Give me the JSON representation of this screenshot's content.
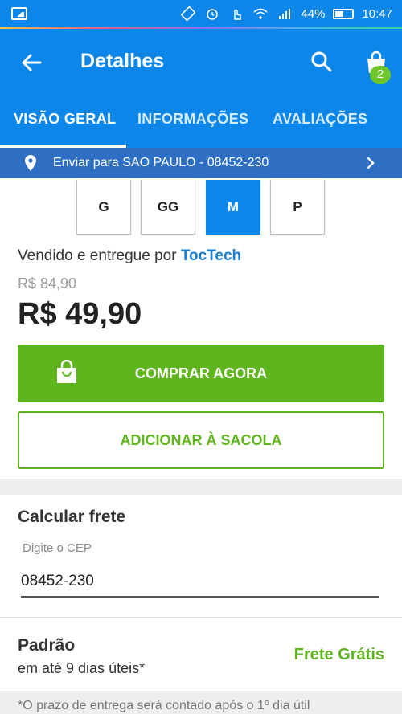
{
  "status_bar": {
    "battery": "44%",
    "time": "10:47"
  },
  "app_bar": {
    "title": "Detalhes",
    "cart_count": "2"
  },
  "tabs": [
    {
      "label": "VISÃO GERAL",
      "active": true
    },
    {
      "label": "INFORMAÇÕES",
      "active": false
    },
    {
      "label": "AVALIAÇÕES",
      "active": false
    }
  ],
  "shipping_bar": {
    "text": "Enviar para SAO PAULO - 08452-230"
  },
  "sizes": [
    {
      "label": "G",
      "selected": false
    },
    {
      "label": "GG",
      "selected": false
    },
    {
      "label": "M",
      "selected": true
    },
    {
      "label": "P",
      "selected": false
    }
  ],
  "seller": {
    "prefix": "Vendido e entregue por",
    "name": "TocTech"
  },
  "pricing": {
    "old_price": "R$ 84,90",
    "price": "R$ 49,90"
  },
  "actions": {
    "buy_now": "COMPRAR AGORA",
    "add_to_bag": "ADICIONAR À SACOLA"
  },
  "freight": {
    "title": "Calcular frete",
    "cep_label": "Digite o CEP",
    "cep_value": "08452-230",
    "option_name": "Padrão",
    "option_days": "em até 9 dias úteis*",
    "option_price": "Frete Grátis",
    "note": "*O prazo de entrega será contado após o 1º dia útil"
  },
  "colors": {
    "primary": "#0c86e8",
    "ship_bar": "#2e6fc3",
    "green": "#5eb51d"
  }
}
